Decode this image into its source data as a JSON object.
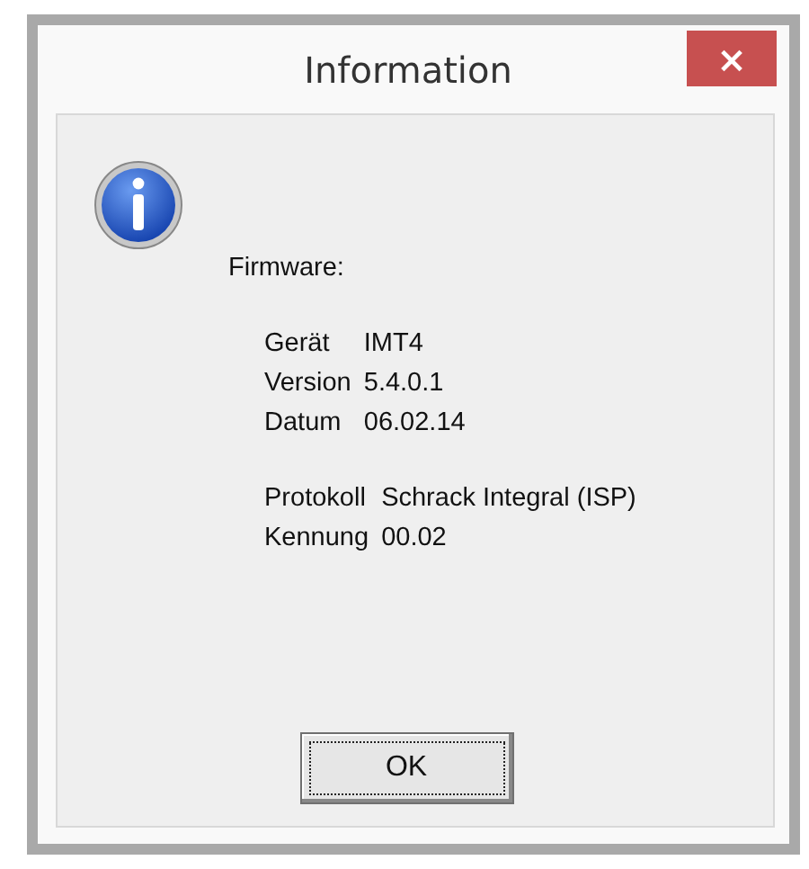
{
  "window": {
    "title": "Information",
    "close_label": "×"
  },
  "heading": "Firmware:",
  "groups": [
    {
      "rows": [
        {
          "label": "Gerät",
          "value": "IMT4"
        },
        {
          "label": "Version",
          "value": "5.4.0.1"
        },
        {
          "label": "Datum",
          "value": "06.02.14"
        }
      ]
    },
    {
      "rows": [
        {
          "label": "Protokoll",
          "value": "Schrack Integral (ISP)"
        },
        {
          "label": "Kennung",
          "value": "00.02"
        }
      ]
    }
  ],
  "buttons": [
    {
      "label": "OK",
      "focused": true
    }
  ]
}
